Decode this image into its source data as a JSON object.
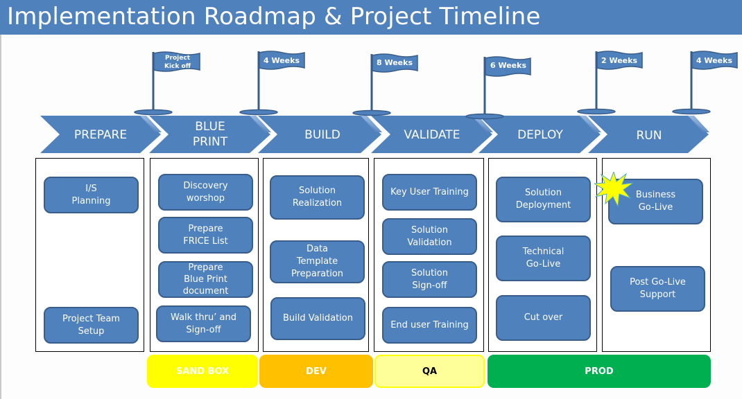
{
  "header": {
    "title": "Implementation Roadmap & Project Timeline"
  },
  "colors": {
    "header_bg": "#4F81BD",
    "shape_fill": "#4F81BD",
    "shape_border": "#385D8A",
    "sandbox": "#FFFF00",
    "dev": "#FFC000",
    "qa": "#FFFF99",
    "prod": "#00B050",
    "burst": "#FFFF00"
  },
  "milestones": [
    {
      "label": "Project\nKick off",
      "icon": "flag-icon"
    },
    {
      "label": "4 Weeks",
      "icon": "flag-icon"
    },
    {
      "label": "8 Weeks",
      "icon": "flag-icon"
    },
    {
      "label": "6 Weeks",
      "icon": "flag-icon"
    },
    {
      "label": "2 Weeks",
      "icon": "flag-icon"
    },
    {
      "label": "4 Weeks",
      "icon": "flag-icon"
    }
  ],
  "phases": [
    {
      "label": "PREPARE",
      "tasks": [
        "I/S\nPlanning",
        "Project Team\nSetup"
      ]
    },
    {
      "label": "BLUE\nPRINT",
      "tasks": [
        "Discovery\nworshop",
        "Prepare\nFRICE List",
        "Prepare\nBlue Print\ndocument",
        "Walk thru’ and\nSign-off"
      ]
    },
    {
      "label": "BUILD",
      "tasks": [
        "Solution\nRealization",
        "Data\nTemplate\nPreparation",
        "Build Validation"
      ]
    },
    {
      "label": "VALIDATE",
      "tasks": [
        "Key User Training",
        "Solution\nValidation",
        "Solution\nSign-off",
        "End user Training"
      ]
    },
    {
      "label": "DEPLOY",
      "tasks": [
        "Solution\nDeployment",
        "Technical\nGo-Live",
        "Cut over"
      ]
    },
    {
      "label": "RUN",
      "tasks": [
        "Business\nGo-Live",
        "Post Go-Live\nSupport"
      ],
      "highlight_icon": "starburst-icon"
    }
  ],
  "environments": [
    {
      "label": "SAND BOX"
    },
    {
      "label": "DEV"
    },
    {
      "label": "QA"
    },
    {
      "label": "PROD"
    }
  ]
}
